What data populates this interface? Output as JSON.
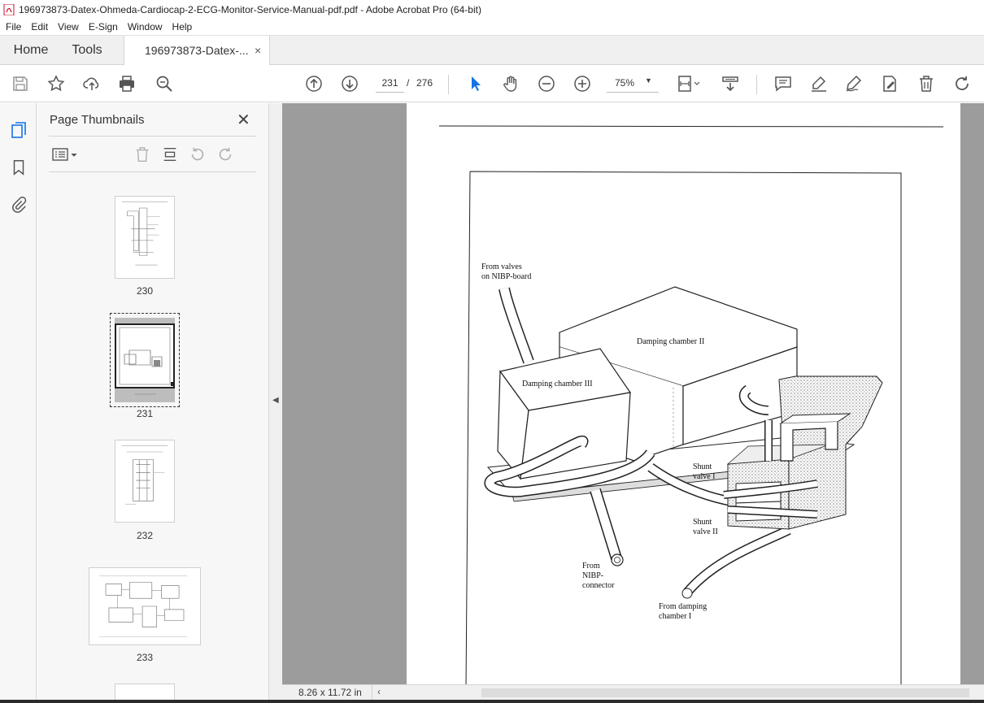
{
  "window": {
    "title": "196973873-Datex-Ohmeda-Cardiocap-2-ECG-Monitor-Service-Manual-pdf.pdf - Adobe Acrobat Pro (64-bit)"
  },
  "menu": [
    "File",
    "Edit",
    "View",
    "E-Sign",
    "Window",
    "Help"
  ],
  "tabs": {
    "home": "Home",
    "tools": "Tools",
    "document": "196973873-Datex-...",
    "close_glyph": "×"
  },
  "toolbar": {
    "current_page": "231",
    "page_separator": "/",
    "total_pages": "276",
    "zoom": "75%",
    "icons": [
      "save-icon",
      "bookmark-star-icon",
      "upload-icon",
      "print-icon",
      "search-zoom-icon",
      "page-up-icon",
      "page-down-icon",
      "select-cursor-icon",
      "hand-icon",
      "zoom-out-icon",
      "zoom-in-icon",
      "fit-page-icon",
      "scroll-mode-icon",
      "comment-icon",
      "highlight-icon",
      "sign-icon",
      "edit-icon",
      "delete-icon",
      "rotate-icon"
    ]
  },
  "sidebar": {
    "panel_title": "Page Thumbnails",
    "close_glyph": "✕",
    "thumbnails": [
      {
        "page": "230",
        "selected": false
      },
      {
        "page": "231",
        "selected": true
      },
      {
        "page": "232",
        "selected": false
      },
      {
        "page": "233",
        "selected": false
      }
    ]
  },
  "document": {
    "labels": {
      "from_valves_1": "From valves",
      "from_valves_2": "on NIBP-board",
      "damping_ii": "Damping chamber II",
      "damping_iii": "Damping chamber III",
      "shunt_i_1": "Shunt",
      "shunt_i_2": "valve I",
      "shunt_ii_1": "Shunt",
      "shunt_ii_2": "valve II",
      "from_nibp_1": "From",
      "from_nibp_2": "NIBP-",
      "from_nibp_3": "connector",
      "from_damping_1": "From damping",
      "from_damping_2": "chamber I"
    }
  },
  "status": {
    "page_size": "8.26 x 11.72 in"
  },
  "colors": {
    "accent_blue": "#1473e6",
    "panel_bg": "#f7f7f7",
    "doc_bg": "#9c9c9c"
  }
}
